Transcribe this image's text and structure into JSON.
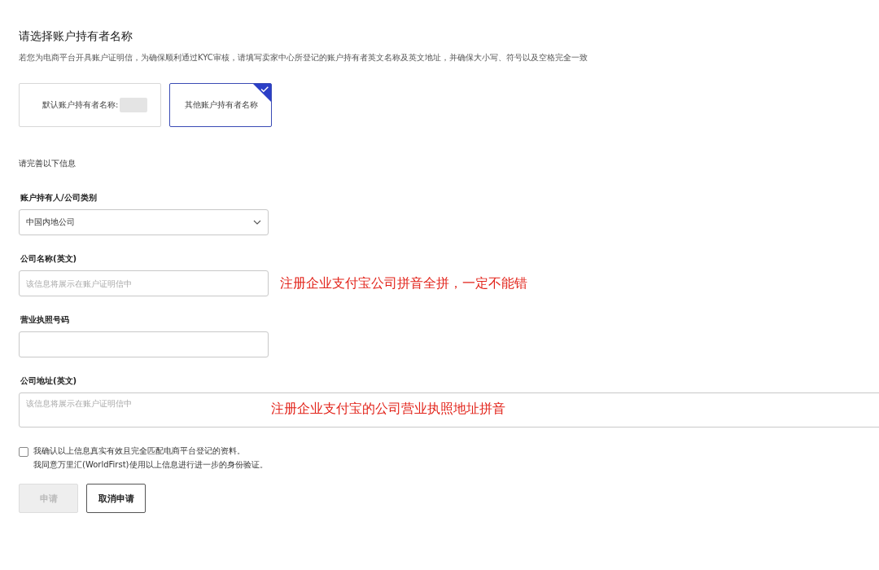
{
  "title": "请选择账户持有者名称",
  "description": "若您为电商平台开具账户证明信，为确保顺利通过KYC审核，请填写卖家中心所登记的账户持有者英文名称及英文地址，并确保大小写、符号以及空格完全一致",
  "name_options": [
    {
      "label": "默认账户持有者名称:",
      "redacted": true,
      "selected": false
    },
    {
      "label": "其他账户持有者名称",
      "redacted": false,
      "selected": true
    }
  ],
  "section_heading": "请完善以下信息",
  "fields": [
    {
      "kind": "select",
      "label": "账户持有人/公司类别",
      "value": "中国内地公司"
    },
    {
      "kind": "input",
      "label": "公司名称(英文)",
      "placeholder": "该信息将展示在账户证明信中",
      "annotation": "注册企业支付宝公司拼音全拼，一定不能错"
    },
    {
      "kind": "input",
      "label": "营业执照号码"
    },
    {
      "kind": "textarea",
      "label": "公司地址(英文)",
      "placeholder": "该信息将展示在账户证明信中",
      "annotation": "注册企业支付宝的公司营业执照地址拼音"
    }
  ],
  "consent": {
    "checked": false,
    "lines": [
      "我确认以上信息真实有效且完全匹配电商平台登记的资料。",
      "我同意万里汇(WorldFirst)使用以上信息进行进一步的身份验证。"
    ]
  },
  "buttons": [
    {
      "label": "申请",
      "disabled": true
    },
    {
      "label": "取消申请",
      "disabled": false
    }
  ]
}
